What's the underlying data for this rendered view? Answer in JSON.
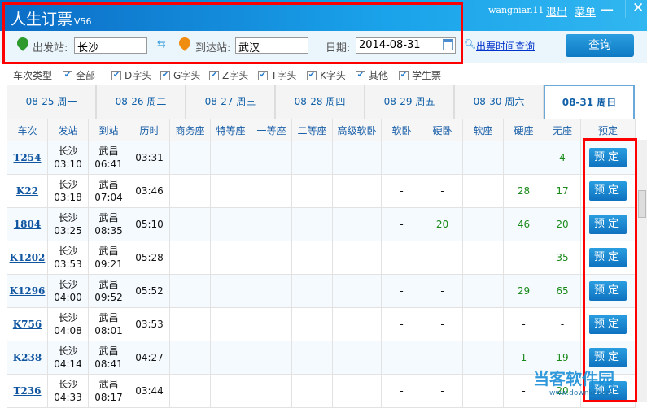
{
  "app": {
    "title": "人生订票",
    "version": "V56",
    "user": "wangnian11",
    "logout": "退出",
    "menu": "菜单",
    "minimize": "—",
    "close": "✕"
  },
  "search": {
    "from_label": "出发站:",
    "from_value": "长沙",
    "to_label": "到达站:",
    "to_value": "武汉",
    "date_label": "日期:",
    "date_value": "2014-08-31",
    "ticket_time_link": "出票时间查询",
    "query_button": "查询"
  },
  "filters": {
    "label": "车次类型",
    "items": [
      "全部",
      "D字头",
      "G字头",
      "Z字头",
      "T字头",
      "K字头",
      "其他",
      "学生票"
    ]
  },
  "date_tabs": [
    "08-25  周一",
    "08-26  周二",
    "08-27  周三",
    "08-28  周四",
    "08-29  周五",
    "08-30  周六",
    "08-31  周日"
  ],
  "columns": [
    "车次",
    "发站",
    "到站",
    "历时",
    "商务座",
    "特等座",
    "一等座",
    "二等座",
    "高级软卧",
    "软卧",
    "硬卧",
    "软座",
    "硬座",
    "无座",
    "预定"
  ],
  "book_label": "预定",
  "rows": [
    {
      "train": "T254",
      "from": "长沙",
      "dep": "03:10",
      "to": "武昌",
      "arr": "06:41",
      "dur": "03:31",
      "rw": "-",
      "yw": "-",
      "rz": "",
      "yz": "-",
      "wz": "4"
    },
    {
      "train": "K22",
      "from": "长沙",
      "dep": "03:18",
      "to": "武昌",
      "arr": "07:04",
      "dur": "03:46",
      "rw": "-",
      "yw": "-",
      "rz": "",
      "yz": "28",
      "wz": "17"
    },
    {
      "train": "1804",
      "from": "长沙",
      "dep": "03:25",
      "to": "武昌",
      "arr": "08:35",
      "dur": "05:10",
      "rw": "-",
      "yw": "20",
      "rz": "",
      "yz": "46",
      "wz": "20"
    },
    {
      "train": "K1202",
      "from": "长沙",
      "dep": "03:53",
      "to": "武昌",
      "arr": "09:21",
      "dur": "05:28",
      "rw": "-",
      "yw": "-",
      "rz": "",
      "yz": "-",
      "wz": "35"
    },
    {
      "train": "K1296",
      "from": "长沙",
      "dep": "04:00",
      "to": "武昌",
      "arr": "09:52",
      "dur": "05:52",
      "rw": "-",
      "yw": "-",
      "rz": "",
      "yz": "29",
      "wz": "65"
    },
    {
      "train": "K756",
      "from": "长沙",
      "dep": "04:08",
      "to": "武昌",
      "arr": "08:01",
      "dur": "03:53",
      "rw": "-",
      "yw": "-",
      "rz": "",
      "yz": "-",
      "wz": "-"
    },
    {
      "train": "K238",
      "from": "长沙",
      "dep": "04:14",
      "to": "武昌",
      "arr": "08:41",
      "dur": "04:27",
      "rw": "-",
      "yw": "-",
      "rz": "",
      "yz": "1",
      "wz": "19"
    },
    {
      "train": "T236",
      "from": "长沙",
      "dep": "04:33",
      "to": "武昌",
      "arr": "08:17",
      "dur": "03:44",
      "rw": "-",
      "yw": "-",
      "rz": "",
      "yz": "-",
      "wz": "20"
    }
  ],
  "watermark": {
    "name": "当客软件园",
    "url": "www.downkr.com"
  }
}
